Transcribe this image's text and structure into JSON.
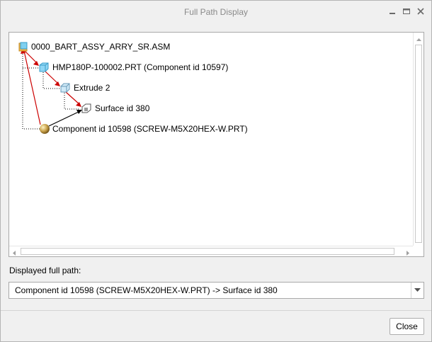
{
  "window": {
    "title": "Full Path Display",
    "controls": [
      "minimize-icon",
      "maximize-icon",
      "close-icon"
    ]
  },
  "tree": {
    "nodes": [
      {
        "label": "0000_BART_ASSY_ARRY_SR.ASM",
        "icon": "assembly-icon"
      },
      {
        "label": "HMP180P-100002.PRT (Component id 10597)",
        "icon": "part-icon"
      },
      {
        "label": "Extrude 2",
        "icon": "extrude-feature-icon"
      },
      {
        "label": "Surface id 380",
        "icon": "surface-icon"
      },
      {
        "label": "Component id 10598 (SCREW-M5X20HEX-W.PRT)",
        "icon": "component-sphere-icon"
      }
    ]
  },
  "path": {
    "label": "Displayed full path:",
    "value": "Component id 10598 (SCREW-M5X20HEX-W.PRT) -> Surface id 380"
  },
  "footer": {
    "close_label": "Close"
  },
  "colors": {
    "reference_arrow": "#cc0000",
    "path_arrow": "#000000",
    "tree_line": "#000000"
  }
}
